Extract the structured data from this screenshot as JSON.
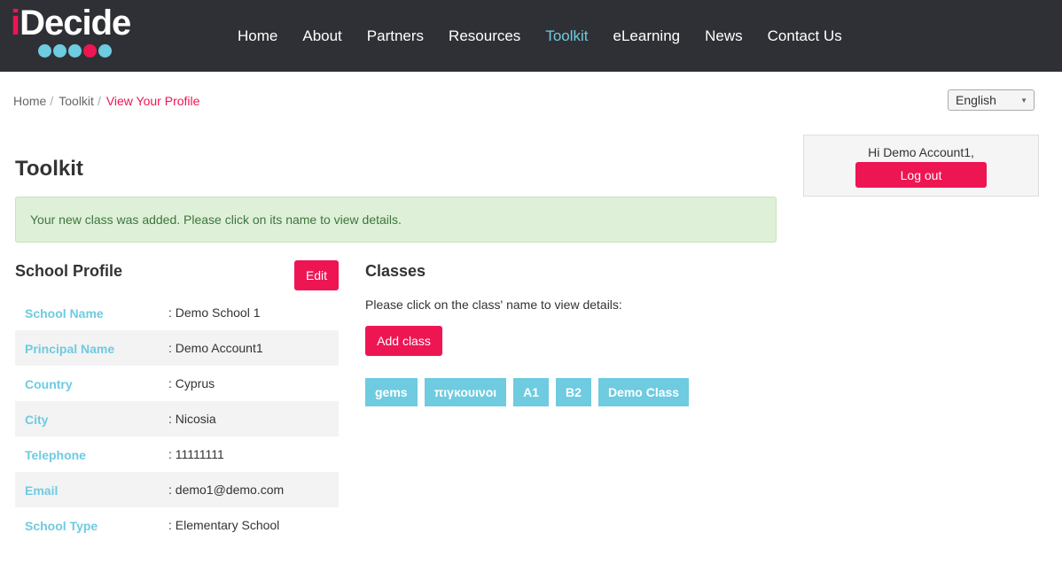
{
  "brand": {
    "logo_text_i": "i",
    "logo_text_rest": "Decide",
    "dot_colors": [
      "#6ecbe0",
      "#6ecbe0",
      "#6ecbe0",
      "#ee1553",
      "#6ecbe0"
    ]
  },
  "nav": {
    "items": [
      "Home",
      "About",
      "Partners",
      "Resources",
      "Toolkit",
      "eLearning",
      "News",
      "Contact Us"
    ],
    "active": "Toolkit"
  },
  "breadcrumb": {
    "items": [
      "Home",
      "Toolkit"
    ],
    "current": "View Your Profile"
  },
  "language": {
    "selected": "English"
  },
  "page": {
    "title": "Toolkit"
  },
  "alert": {
    "message": "Your new class was added. Please click on its name to view details."
  },
  "profile": {
    "title": "School Profile",
    "edit_label": "Edit",
    "fields": [
      {
        "label": "School Name",
        "value": ": Demo School 1"
      },
      {
        "label": "Principal Name",
        "value": ": Demo Account1"
      },
      {
        "label": "Country",
        "value": ": Cyprus"
      },
      {
        "label": "City",
        "value": ": Nicosia"
      },
      {
        "label": "Telephone",
        "value": ": 11111111"
      },
      {
        "label": "Email",
        "value": ": demo1@demo.com"
      },
      {
        "label": "School Type",
        "value": ": Elementary School"
      }
    ]
  },
  "classes": {
    "title": "Classes",
    "hint": "Please click on the class' name to view details:",
    "add_label": "Add class",
    "items": [
      "gems",
      "πιγκουινοι",
      "A1",
      "B2",
      "Demo Class"
    ]
  },
  "account": {
    "greeting": "Hi Demo Account1,",
    "logout_label": "Log out"
  },
  "colors": {
    "accent_pink": "#ee1553",
    "accent_blue": "#6ecbe0",
    "topbar": "#2f3035"
  }
}
